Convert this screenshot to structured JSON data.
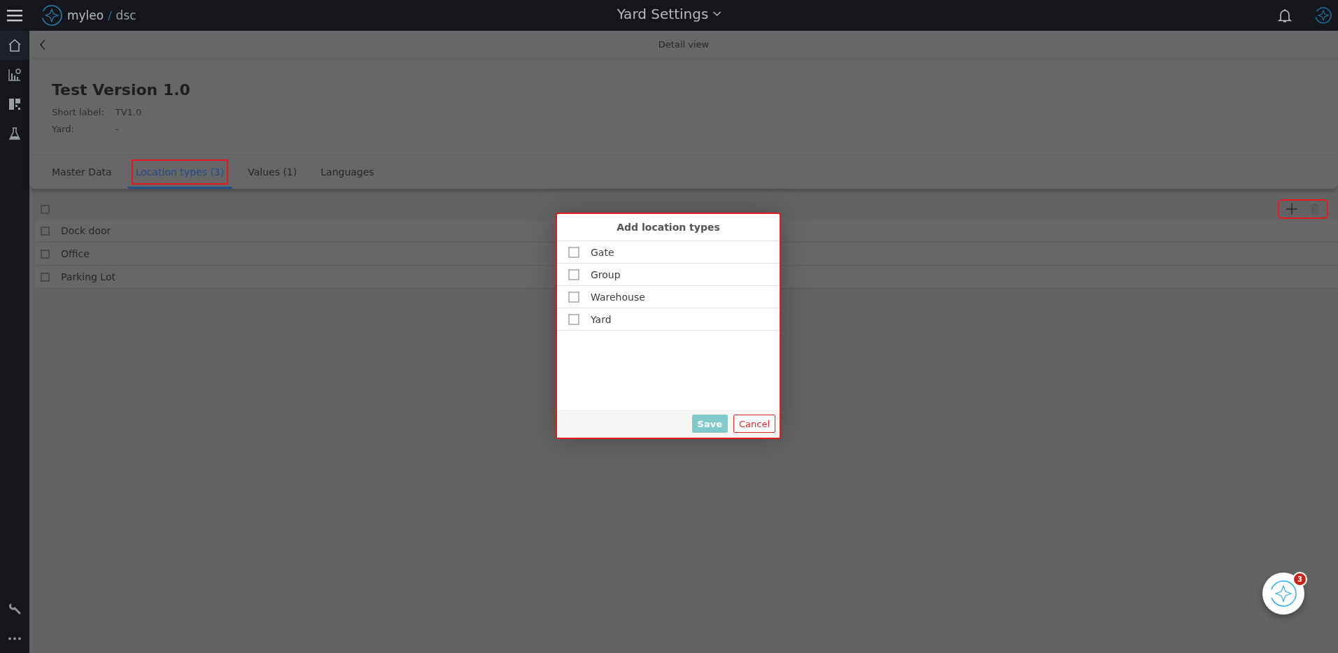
{
  "app": {
    "logo_name": "myleo",
    "logo_separator": "/",
    "logo_product": "dsc",
    "title": "Yard Settings"
  },
  "nav": [
    {
      "kind": "home",
      "selected": true
    },
    {
      "kind": "chart",
      "selected": false
    },
    {
      "kind": "dashboard",
      "selected": false
    },
    {
      "kind": "flask",
      "selected": false
    }
  ],
  "nav_bottom": [
    {
      "kind": "wrench",
      "selected": false
    },
    {
      "kind": "more",
      "selected": false
    }
  ],
  "detail": {
    "header": "Detail view",
    "title": "Test Version 1.0",
    "fields": [
      {
        "label": "Short label:",
        "value": "TV1.0"
      },
      {
        "label": "Yard:",
        "value": "-"
      }
    ]
  },
  "tabs": [
    {
      "label": "Master Data",
      "selected": false,
      "highlighted": false
    },
    {
      "label": "Location types (3)",
      "selected": true,
      "highlighted": true
    },
    {
      "label": "Values (1)",
      "selected": false,
      "highlighted": false
    },
    {
      "label": "Languages",
      "selected": false,
      "highlighted": false
    }
  ],
  "list": {
    "select_all_checked": false,
    "toolbar_highlighted": true,
    "rows": [
      {
        "label": "Dock door",
        "checked": false
      },
      {
        "label": "Office",
        "checked": false
      },
      {
        "label": "Parking Lot",
        "checked": false
      }
    ]
  },
  "dialog": {
    "title": "Add location types",
    "highlighted": true,
    "options": [
      {
        "label": "Gate",
        "checked": false
      },
      {
        "label": "Group",
        "checked": false
      },
      {
        "label": "Warehouse",
        "checked": false
      },
      {
        "label": "Yard",
        "checked": false
      }
    ],
    "save": {
      "label": "Save",
      "disabled": true
    },
    "cancel": "Cancel"
  },
  "assistant": {
    "badge": "3"
  }
}
